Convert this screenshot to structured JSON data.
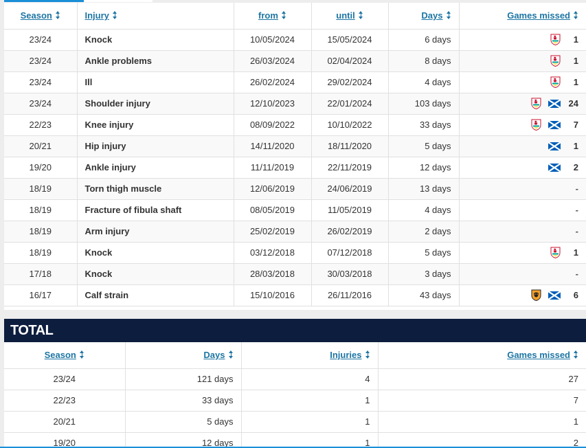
{
  "injuries": {
    "headers": {
      "season": "Season",
      "injury": "Injury",
      "from": "from",
      "until": "until",
      "days": "Days",
      "games_missed": "Games missed"
    },
    "rows": [
      {
        "season": "23/24",
        "injury": "Knock",
        "from": "10/05/2024",
        "until": "15/05/2024",
        "days": "6 days",
        "games": "1",
        "icons": [
          "liverpool-crest-icon"
        ]
      },
      {
        "season": "23/24",
        "injury": "Ankle problems",
        "from": "26/03/2024",
        "until": "02/04/2024",
        "days": "8 days",
        "games": "1",
        "icons": [
          "liverpool-crest-icon"
        ]
      },
      {
        "season": "23/24",
        "injury": "Ill",
        "from": "26/02/2024",
        "until": "29/02/2024",
        "days": "4 days",
        "games": "1",
        "icons": [
          "liverpool-crest-icon"
        ]
      },
      {
        "season": "23/24",
        "injury": "Shoulder injury",
        "from": "12/10/2023",
        "until": "22/01/2024",
        "days": "103 days",
        "games": "24",
        "icons": [
          "liverpool-crest-icon",
          "scotland-flag-icon"
        ]
      },
      {
        "season": "22/23",
        "injury": "Knee injury",
        "from": "08/09/2022",
        "until": "10/10/2022",
        "days": "33 days",
        "games": "7",
        "icons": [
          "liverpool-crest-icon",
          "scotland-flag-icon"
        ]
      },
      {
        "season": "20/21",
        "injury": "Hip injury",
        "from": "14/11/2020",
        "until": "18/11/2020",
        "days": "5 days",
        "games": "1",
        "icons": [
          "scotland-flag-icon"
        ]
      },
      {
        "season": "19/20",
        "injury": "Ankle injury",
        "from": "11/11/2019",
        "until": "22/11/2019",
        "days": "12 days",
        "games": "2",
        "icons": [
          "scotland-flag-icon"
        ]
      },
      {
        "season": "18/19",
        "injury": "Torn thigh muscle",
        "from": "12/06/2019",
        "until": "24/06/2019",
        "days": "13 days",
        "games": "-",
        "icons": []
      },
      {
        "season": "18/19",
        "injury": "Fracture of fibula shaft",
        "from": "08/05/2019",
        "until": "11/05/2019",
        "days": "4 days",
        "games": "-",
        "icons": []
      },
      {
        "season": "18/19",
        "injury": "Arm injury",
        "from": "25/02/2019",
        "until": "26/02/2019",
        "days": "2 days",
        "games": "-",
        "icons": []
      },
      {
        "season": "18/19",
        "injury": "Knock",
        "from": "03/12/2018",
        "until": "07/12/2018",
        "days": "5 days",
        "games": "1",
        "icons": [
          "liverpool-crest-icon"
        ]
      },
      {
        "season": "17/18",
        "injury": "Knock",
        "from": "28/03/2018",
        "until": "30/03/2018",
        "days": "3 days",
        "games": "-",
        "icons": []
      },
      {
        "season": "16/17",
        "injury": "Calf strain",
        "from": "15/10/2016",
        "until": "26/11/2016",
        "days": "43 days",
        "games": "6",
        "icons": [
          "hull-crest-icon",
          "scotland-flag-icon"
        ]
      }
    ]
  },
  "total": {
    "title": "TOTAL",
    "headers": {
      "season": "Season",
      "days": "Days",
      "injuries": "Injuries",
      "games_missed": "Games missed"
    },
    "rows": [
      {
        "season": "23/24",
        "days": "121 days",
        "injuries": "4",
        "games": "27"
      },
      {
        "season": "22/23",
        "days": "33 days",
        "injuries": "1",
        "games": "7"
      },
      {
        "season": "20/21",
        "days": "5 days",
        "injuries": "1",
        "games": "1"
      },
      {
        "season": "19/20",
        "days": "12 days",
        "injuries": "1",
        "games": "2"
      }
    ]
  },
  "colors": {
    "link": "#1d75a3",
    "header_bar": "#0d1d3e",
    "accent": "#1a8fd8",
    "liverpool_red": "#c8102e",
    "scotland_blue": "#005eb8",
    "hull_amber": "#f5a12d"
  }
}
